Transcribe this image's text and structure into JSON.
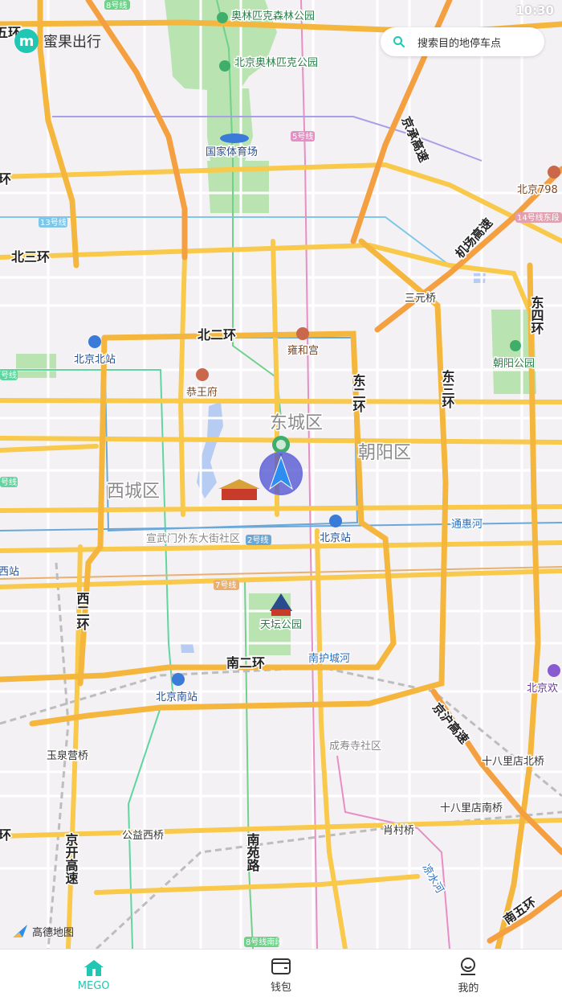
{
  "status": {
    "time": "10:30"
  },
  "app": {
    "name": "蜜果出行",
    "logo_letter": "m"
  },
  "search": {
    "placeholder": "搜索目的地停车点"
  },
  "map": {
    "attribution": "高德地图",
    "road_labels": {
      "beisanhuan": "北三环",
      "beierhuan": "北二环",
      "dongerhuan": "东二环",
      "dongsanhuan": "东三环",
      "dongsihuan": "东四环",
      "xierhuan": "西二环",
      "nanerhuan": "南二环",
      "jingchenggaosu": "京承高速",
      "jichanggaosu": "机场高速",
      "jinghugaosu": "京沪高速",
      "jingkaigaosu": "京开高速",
      "nanyuanlu": "南苑路",
      "nanwuhuan": "南五环",
      "huan_tl": "五环",
      "huan_l1": "环",
      "huan_l2": "环"
    },
    "districts": {
      "dongcheng": "东城区",
      "xicheng": "西城区",
      "chaoyang": "朝阳区"
    },
    "pois": {
      "aolin_forest": "奥林匹克森林公园",
      "aolin_park": "北京奥林匹克公园",
      "stadium": "国家体育场",
      "yonghegong": "雍和宫",
      "gongwangfu": "恭王府",
      "beijing_north": "北京北站",
      "beijing_station": "北京站",
      "beijing_south": "北京南站",
      "tiantan": "天坛公园",
      "chaoyang_park": "朝阳公园",
      "sanyuanqiao": "三元桥",
      "tonghuihe": "通惠河",
      "nanhuchenghe": "南护城河",
      "xuanwumen": "宣武门外东大街社区",
      "chengshousi": "成寿寺社区",
      "yuquanyingqiao": "玉泉营桥",
      "gongyixiqiao": "公益西桥",
      "xiaocunqiao": "肖村桥",
      "shibalidian_bei": "十八里店北桥",
      "shibalidian_nan": "十八里店南桥",
      "liangshuihe": "凉水河",
      "beijing798": "北京798",
      "beijing_huan": "北京欢",
      "xizhan": "西站"
    },
    "metro": {
      "l8": "8号线",
      "l5": "5号线",
      "l13": "13号线",
      "l14": "14号线东段",
      "l2": "2号线",
      "l7": "7号线",
      "l8s": "8号线南段",
      "l4": "号线",
      "l4b": "号线"
    }
  },
  "tabs": [
    {
      "label": "MEGO",
      "icon": "home-icon",
      "active": true
    },
    {
      "label": "钱包",
      "icon": "wallet-icon",
      "active": false
    },
    {
      "label": "我的",
      "icon": "profile-icon",
      "active": false
    }
  ],
  "colors": {
    "accent": "#22c7b3",
    "road_main": "#f8c94a",
    "road_ring": "#f4a83a"
  }
}
